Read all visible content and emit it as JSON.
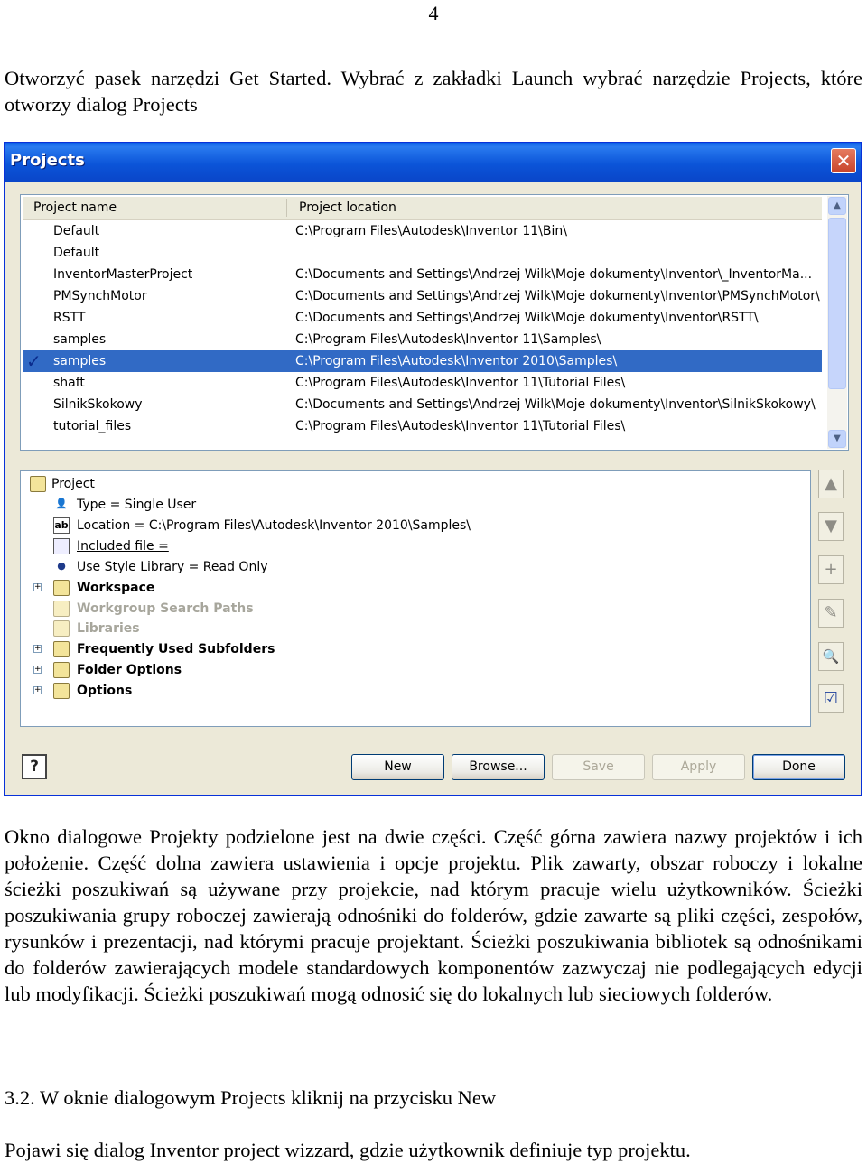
{
  "page_number": "4",
  "intro": "Otworzyć pasek narzędzi Get Started. Wybrać z zakładki Launch wybrać narzędzie Projects, które otworzy dialog Projects",
  "dialog": {
    "title": "Projects",
    "close_glyph": "✕",
    "columns": {
      "name": "Project name",
      "location": "Project location"
    },
    "projects": [
      {
        "name": "Default",
        "location": "C:\\Program Files\\Autodesk\\Inventor 11\\Bin\\"
      },
      {
        "name": "Default",
        "location": ""
      },
      {
        "name": "InventorMasterProject",
        "location": "C:\\Documents and Settings\\Andrzej Wilk\\Moje dokumenty\\Inventor\\_InventorMa..."
      },
      {
        "name": "PMSynchMotor",
        "location": "C:\\Documents and Settings\\Andrzej Wilk\\Moje dokumenty\\Inventor\\PMSynchMotor\\"
      },
      {
        "name": "RSTT",
        "location": "C:\\Documents and Settings\\Andrzej Wilk\\Moje dokumenty\\Inventor\\RSTT\\"
      },
      {
        "name": "samples",
        "location": "C:\\Program Files\\Autodesk\\Inventor 11\\Samples\\"
      },
      {
        "name": "samples",
        "location": "C:\\Program Files\\Autodesk\\Inventor 2010\\Samples\\",
        "selected": true,
        "active": true
      },
      {
        "name": "shaft",
        "location": "C:\\Program Files\\Autodesk\\Inventor 11\\Tutorial Files\\"
      },
      {
        "name": "SilnikSkokowy",
        "location": "C:\\Documents and Settings\\Andrzej Wilk\\Moje dokumenty\\Inventor\\SilnikSkokowy\\"
      },
      {
        "name": "tutorial_files",
        "location": "C:\\Program Files\\Autodesk\\Inventor 11\\Tutorial Files\\"
      }
    ],
    "active_mark": "✓",
    "tree": {
      "root": "Project",
      "type": "Type = Single User",
      "location": "Location = C:\\Program Files\\Autodesk\\Inventor 2010\\Samples\\",
      "included_file": "Included file =",
      "style_library": "Use Style Library = Read Only",
      "workspace": "Workspace",
      "workgroup_search_paths": "Workgroup Search Paths",
      "libraries": "Libraries",
      "frequently_used_subfolders": "Frequently Used Subfolders",
      "folder_options": "Folder Options",
      "options": "Options"
    },
    "buttons": {
      "new": "New",
      "browse": "Browse...",
      "save": "Save",
      "apply": "Apply",
      "done": "Done"
    },
    "help_glyph": "?",
    "side_glyphs": {
      "up": "▲",
      "down": "▼",
      "add": "+",
      "edit": "✎",
      "find": "🔍",
      "edit_path": "☑"
    }
  },
  "description": "Okno dialogowe Projekty podzielone jest na dwie części. Część górna zawiera nazwy projektów i ich położenie. Część dolna zawiera ustawienia i opcje projektu. Plik zawarty, obszar roboczy i lokalne ścieżki poszukiwań są używane przy projekcie, nad którym pracuje wielu użytkowników. Ścieżki poszukiwania grupy roboczej zawierają odnośniki do folderów, gdzie zawarte są pliki części, zespołów, rysunków i prezentacji, nad którymi pracuje projektant. Ścieżki poszukiwania bibliotek są odnośnikami do folderów zawierających modele standardowych komponentów zazwyczaj nie podlegających edycji lub modyfikacji. Ścieżki poszukiwań mogą odnosić się do lokalnych lub sieciowych folderów.",
  "step": "3.2. W oknie dialogowym Projects kliknij na przycisku New",
  "outro": "Pojawi się dialog Inventor project wizzard, gdzie użytkownik definiuje typ projektu."
}
